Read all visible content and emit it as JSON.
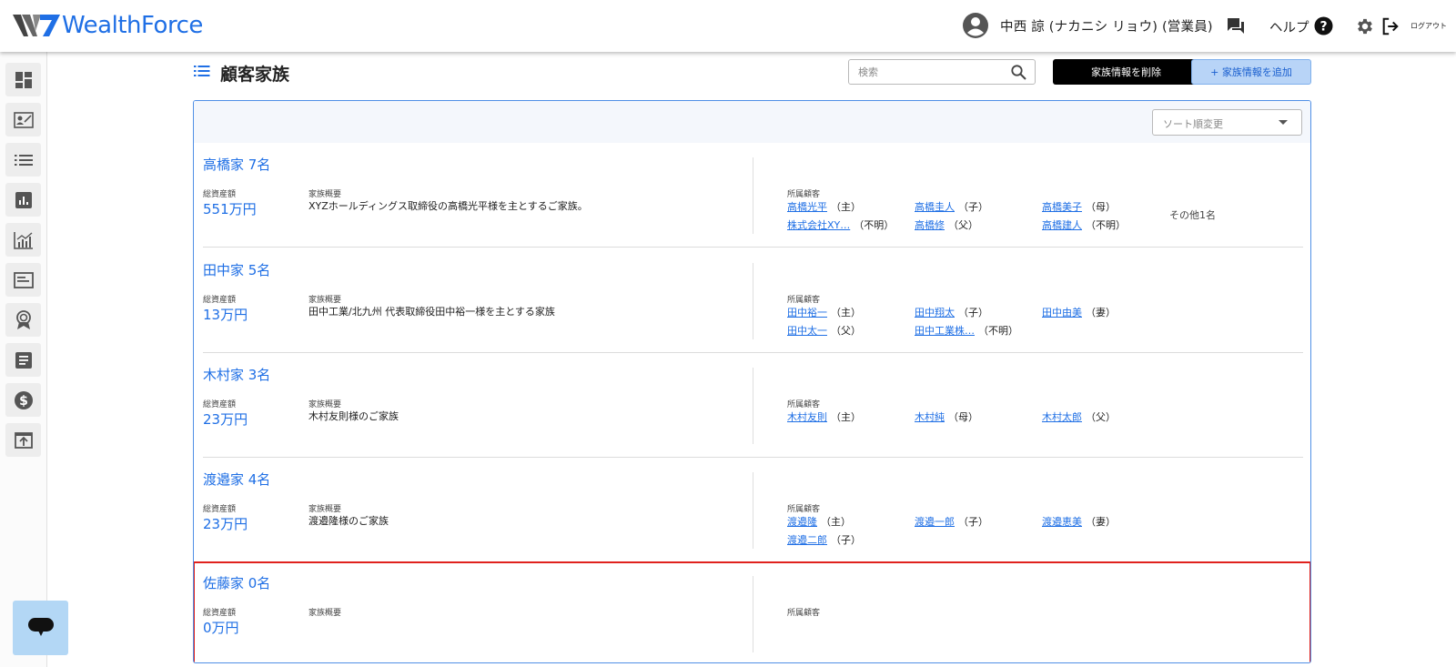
{
  "header": {
    "logo_text": "WealthForce",
    "user_name": "中西 諒 (ナカニシ リョウ) (営業員)",
    "help_label": "ヘルプ",
    "logout_label": "ログアウト",
    "icons": [
      "account-circle-icon",
      "chat-bubbles-icon",
      "help-circle-icon",
      "gear-icon",
      "logout-icon"
    ]
  },
  "sidebar": {
    "items": [
      "dashboard-icon",
      "customer-card-icon",
      "list-icon",
      "bar-chart-icon",
      "line-chart-icon",
      "document-window-icon",
      "award-icon",
      "notes-icon",
      "dollar-icon",
      "upload-icon"
    ]
  },
  "page": {
    "title": "顧客家族",
    "search_placeholder": "検索",
    "delete_button": "家族情報を削除",
    "add_button": "+ 家族情報を追加",
    "sort_label": "ソート順変更"
  },
  "labels": {
    "total_assets": "総資産額",
    "family_summary": "家族概要",
    "members": "所属顧客"
  },
  "families": [
    {
      "name": "高橋家  7名",
      "total": "551万円",
      "summary": "XYZホールディングス取締役の高橋光平様を主とするご家族。",
      "members": [
        {
          "name": "高橋光平",
          "rel": "（主）"
        },
        {
          "name": "高橋圭人",
          "rel": "（子）"
        },
        {
          "name": "高橋美子",
          "rel": "（母）"
        },
        {
          "name": "株式会社XY…",
          "rel": "（不明）"
        },
        {
          "name": "高橋修",
          "rel": "（父）"
        },
        {
          "name": "高橋建人",
          "rel": "（不明）"
        }
      ],
      "others": "その他1名"
    },
    {
      "name": "田中家  5名",
      "total": "13万円",
      "summary": "田中工業/北九州 代表取締役田中裕一様を主とする家族",
      "members": [
        {
          "name": "田中裕一",
          "rel": "（主）"
        },
        {
          "name": "田中翔太",
          "rel": "（子）"
        },
        {
          "name": "田中由美",
          "rel": "（妻）"
        },
        {
          "name": "田中太一",
          "rel": "（父）"
        },
        {
          "name": "田中工業株…",
          "rel": "（不明）"
        }
      ],
      "others": ""
    },
    {
      "name": "木村家  3名",
      "total": "23万円",
      "summary": "木村友則様のご家族",
      "members": [
        {
          "name": "木村友則",
          "rel": "（主）"
        },
        {
          "name": "木村純",
          "rel": "（母）"
        },
        {
          "name": "木村太郎",
          "rel": "（父）"
        }
      ],
      "others": ""
    },
    {
      "name": "渡邉家  4名",
      "total": "23万円",
      "summary": "渡邉隆様のご家族",
      "members": [
        {
          "name": "渡邉隆",
          "rel": "（主）"
        },
        {
          "name": "渡邉一郎",
          "rel": "（子）"
        },
        {
          "name": "渡邉恵美",
          "rel": "（妻）"
        },
        {
          "name": "渡邉二郎",
          "rel": "（子）"
        }
      ],
      "others": ""
    },
    {
      "name": "佐藤家  0名",
      "total": "0万円",
      "summary": "",
      "members": [],
      "others": "",
      "selected": true
    }
  ]
}
